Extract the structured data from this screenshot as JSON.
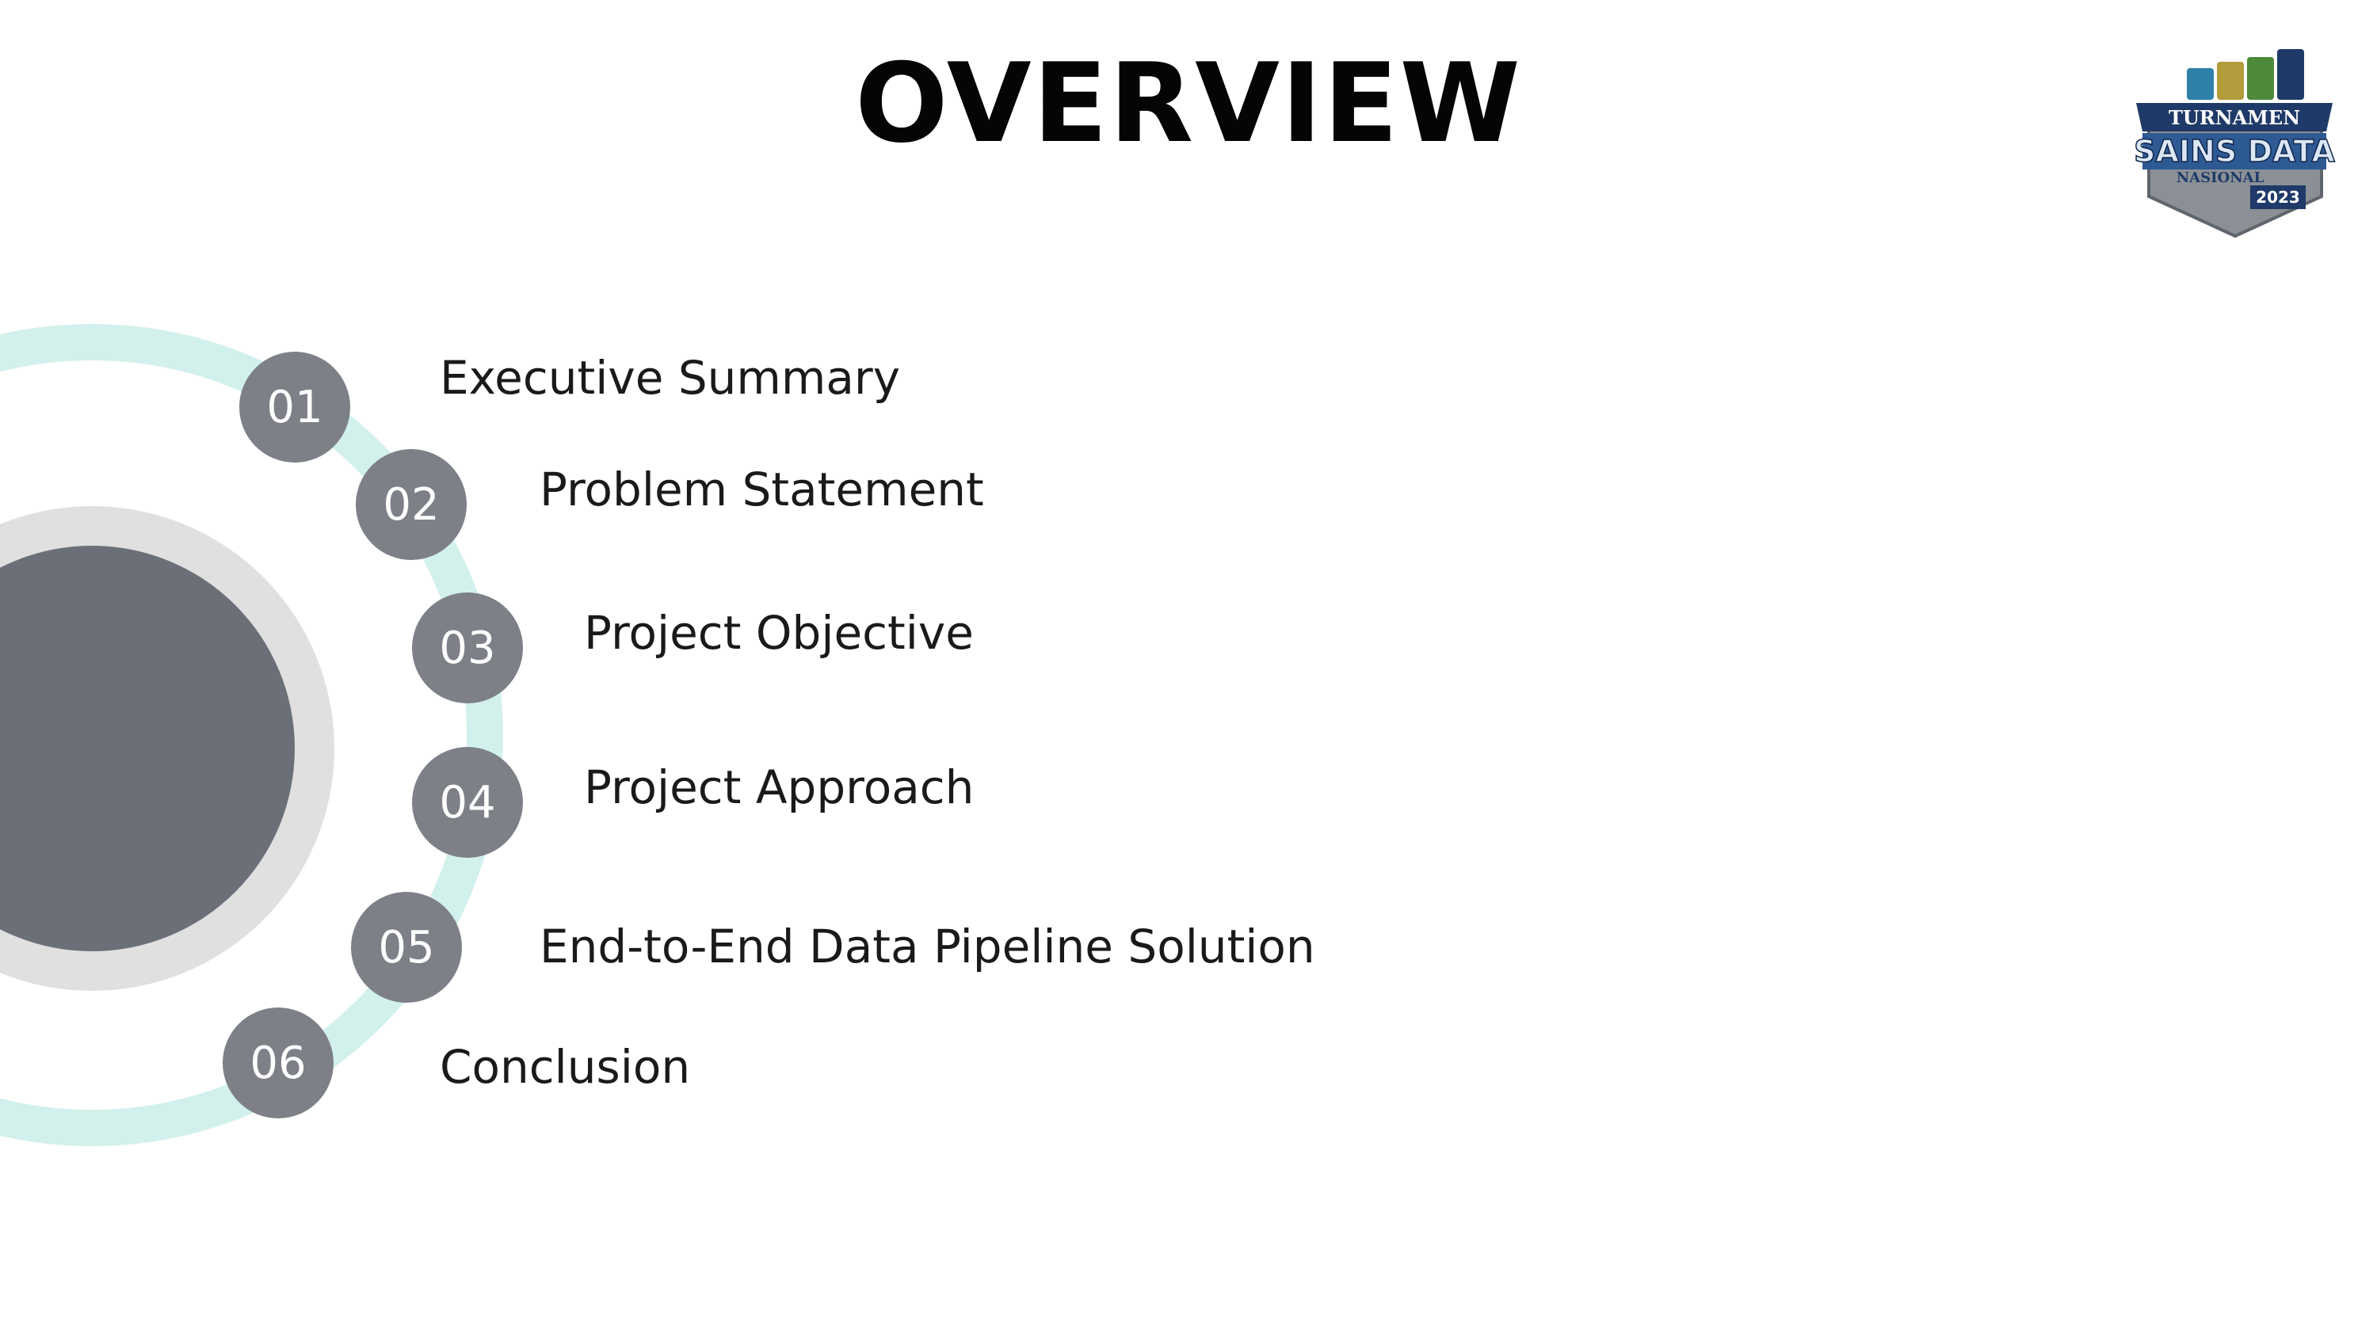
{
  "slide": {
    "title": "OVERVIEW"
  },
  "logo": {
    "line1": "TURNAMEN",
    "line2": "SAINS DATA",
    "line3": "NASIONAL",
    "year": "2023"
  },
  "agenda": {
    "items": [
      {
        "number": "01",
        "label": "Executive Summary"
      },
      {
        "number": "02",
        "label": "Problem Statement"
      },
      {
        "number": "03",
        "label": "Project Objective"
      },
      {
        "number": "04",
        "label": "Project Approach"
      },
      {
        "number": "05",
        "label": "End-to-End Data Pipeline Solution"
      },
      {
        "number": "06",
        "label": "Conclusion"
      }
    ]
  },
  "colors": {
    "ring": "#d3f1ec",
    "inner_ring": "#e0e0e0",
    "center_circle": "#6b6f77",
    "number_badge": "#7d8087",
    "logo_navy": "#1f3a68",
    "logo_steel": "#8a9096"
  }
}
